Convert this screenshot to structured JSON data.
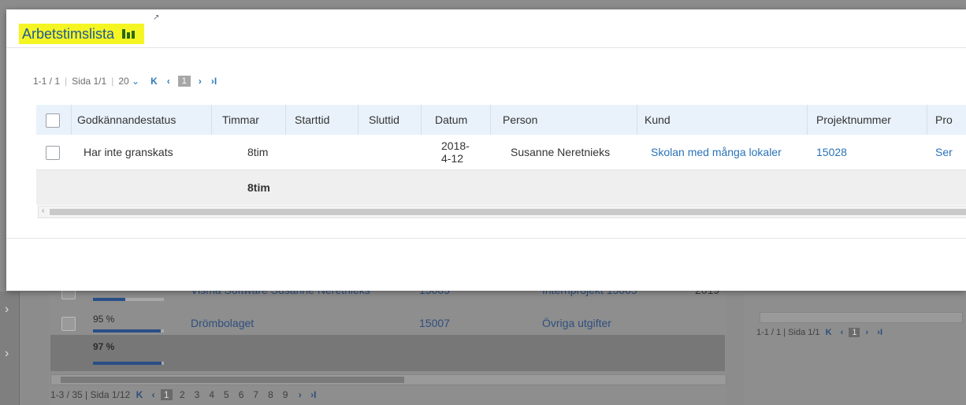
{
  "modal": {
    "title": "Arbetstimslista",
    "pagination": {
      "range": "1-1 / 1",
      "page": "Sida 1/1",
      "per_page": "20",
      "current": "1"
    },
    "columns": [
      "Godkännandestatus",
      "Timmar",
      "Starttid",
      "Sluttid",
      "Datum",
      "Person",
      "Kund",
      "Projektnummer",
      "Pro"
    ],
    "row": {
      "status": "Har inte granskats",
      "hours": "8tim",
      "start": "",
      "end": "",
      "date": "2018-4-12",
      "person": "Susanne Neretnieks",
      "customer": "Skolan med många lokaler",
      "project_no": "15028",
      "project": "Ser"
    },
    "summary": {
      "hours": "8tim"
    }
  },
  "background": {
    "rows": [
      {
        "pct": "",
        "progress": 0.45,
        "customer": "Visma Software Susanne Neretnieks",
        "number": "15005",
        "project": "Internprojekt 15005",
        "year": "2019"
      },
      {
        "pct": "95 %",
        "progress": 0.95,
        "customer": "Drömbolaget",
        "number": "15007",
        "project": "Övriga utgifter",
        "year": ""
      }
    ],
    "summary_pct": "97 %",
    "summary_progress": 0.97,
    "pager_main": {
      "range": "1-3 / 35",
      "page": "Sida 1/12",
      "current": "1",
      "pages": [
        "2",
        "3",
        "4",
        "5",
        "6",
        "7",
        "8",
        "9"
      ]
    },
    "pager_side": {
      "range": "1-1 / 1",
      "page": "Sida 1/1",
      "current": "1"
    }
  },
  "colors": {
    "title_highlight": "#f5f524",
    "link": "#2a73b8",
    "header_bg": "#e9f2fb",
    "progress": "#2a4f86"
  }
}
